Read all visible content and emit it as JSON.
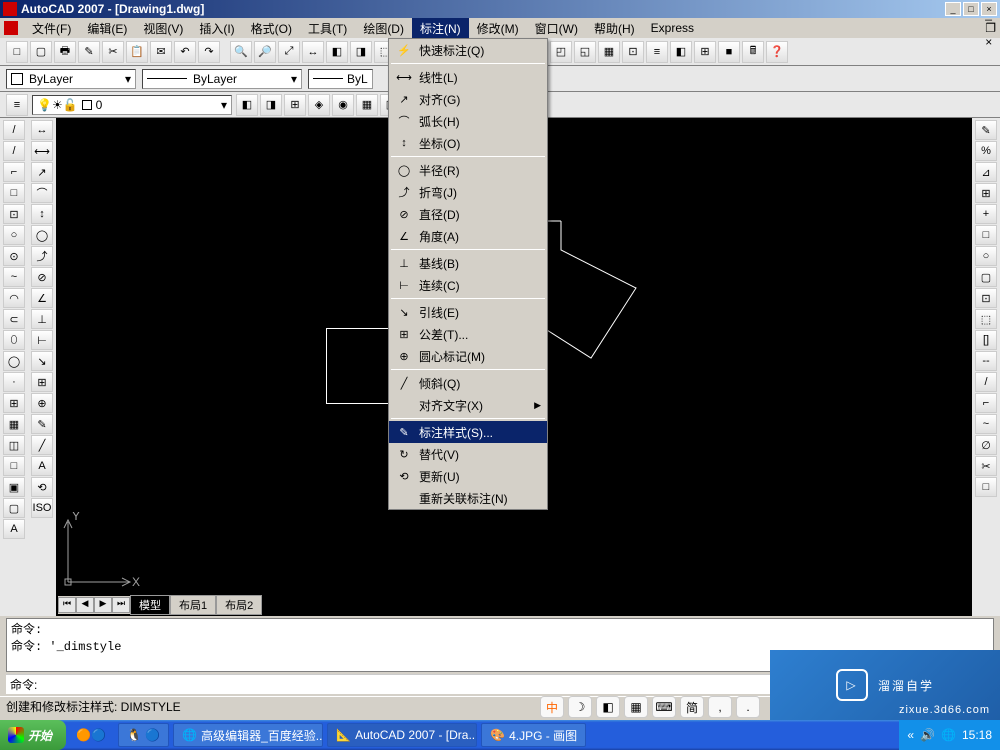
{
  "title": "AutoCAD 2007 - [Drawing1.dwg]",
  "menubar": [
    "文件(F)",
    "编辑(E)",
    "视图(V)",
    "插入(I)",
    "格式(O)",
    "工具(T)",
    "绘图(D)",
    "标注(N)",
    "修改(M)",
    "窗口(W)",
    "帮助(H)",
    "Express"
  ],
  "active_menu_index": 7,
  "groups": {
    "g1": [
      "□",
      "▢",
      "🖶",
      "✎",
      "✂",
      "📋",
      "✉",
      "↶",
      "↷"
    ],
    "g2": [
      "🔍",
      "🔎",
      "⤢",
      "↔",
      "◧",
      "◨",
      "⬚",
      "◫",
      "▦",
      "⊞",
      "▤",
      "A",
      "？"
    ],
    "g3": [
      "◰",
      "◱",
      "▦",
      "⊡",
      "≡",
      "◧",
      "⊞",
      "■",
      "🖩",
      "❓"
    ]
  },
  "props": {
    "color": "ByLayer",
    "linetype": "ByLayer",
    "lineweight": "ByL"
  },
  "layer": {
    "name": "0",
    "icons": [
      "💡",
      "☀",
      "◎",
      "🔒",
      "▢"
    ]
  },
  "layer_tools": [
    "◧",
    "◨",
    "⊞",
    "◈",
    "◉",
    "▦",
    "▣",
    "◐",
    "◑",
    "🔍"
  ],
  "dropdown": [
    {
      "icon": "⚡",
      "label": "快速标注(Q)"
    },
    {
      "sep": true
    },
    {
      "icon": "⟷",
      "label": "线性(L)"
    },
    {
      "icon": "↗",
      "label": "对齐(G)"
    },
    {
      "icon": "⌒",
      "label": "弧长(H)"
    },
    {
      "icon": "↕",
      "label": "坐标(O)"
    },
    {
      "sep": true
    },
    {
      "icon": "◯",
      "label": "半径(R)"
    },
    {
      "icon": "⤴",
      "label": "折弯(J)"
    },
    {
      "icon": "⊘",
      "label": "直径(D)"
    },
    {
      "icon": "∠",
      "label": "角度(A)"
    },
    {
      "sep": true
    },
    {
      "icon": "⊥",
      "label": "基线(B)"
    },
    {
      "icon": "⊢",
      "label": "连续(C)"
    },
    {
      "sep": true
    },
    {
      "icon": "↘",
      "label": "引线(E)"
    },
    {
      "icon": "⊞",
      "label": "公差(T)..."
    },
    {
      "icon": "⊕",
      "label": "圆心标记(M)"
    },
    {
      "sep": true
    },
    {
      "icon": "╱",
      "label": "倾斜(Q)"
    },
    {
      "icon": "",
      "label": "对齐文字(X)",
      "sub": true
    },
    {
      "sep": true
    },
    {
      "icon": "✎",
      "label": "标注样式(S)...",
      "selected": true
    },
    {
      "icon": "↻",
      "label": "替代(V)"
    },
    {
      "icon": "⟲",
      "label": "更新(U)"
    },
    {
      "icon": "",
      "label": "重新关联标注(N)"
    }
  ],
  "left_tools1": [
    "/",
    "/",
    "⌐",
    "□",
    "⊡",
    "○",
    "⊙",
    "~",
    "◠",
    "⊂",
    "⬯",
    "◯",
    "·",
    "⊞",
    "▦",
    "◫",
    "□",
    "▣",
    "▢",
    "A"
  ],
  "left_tools2": [
    "↔",
    "⟷",
    "↗",
    "⌒",
    "↕",
    "◯",
    "⤴",
    "⊘",
    "∠",
    "⊥",
    "⊢",
    "↘",
    "⊞",
    "⊕",
    "✎",
    "╱",
    "A",
    "⟲",
    "ISO"
  ],
  "right_tools": [
    "✎",
    "%",
    "⊿",
    "⊞",
    "+",
    "□",
    "○",
    "▢",
    "⊡",
    "⬚",
    "[]",
    "--",
    "/",
    "⌐",
    "~",
    "∅",
    "✂",
    "□"
  ],
  "ucs": {
    "x": "X",
    "y": "Y"
  },
  "tabs": {
    "nav": [
      "⏮",
      "◀",
      "▶",
      "⏭"
    ],
    "items": [
      "模型",
      "布局1",
      "布局2"
    ],
    "active": 0
  },
  "cmd": {
    "line1": "命令:",
    "line2": "命令: '_dimstyle",
    "prompt": "命令:"
  },
  "status": {
    "left": "创建和修改标注样式:  DIMSTYLE",
    "float": [
      "中",
      "☽",
      "◧",
      "▦",
      "⌨",
      "简",
      ",",
      "."
    ]
  },
  "taskbar": {
    "start": "开始",
    "items": [
      "",
      "高级编辑器_百度经验...",
      "AutoCAD 2007 - [Dra...",
      "4.JPG - 画图"
    ],
    "tray_time": "15:18",
    "tray_icons": [
      "«",
      "🔊",
      "🌐"
    ]
  },
  "watermark": {
    "text": "溜溜自学",
    "sub": "zixue.3d66.com"
  }
}
